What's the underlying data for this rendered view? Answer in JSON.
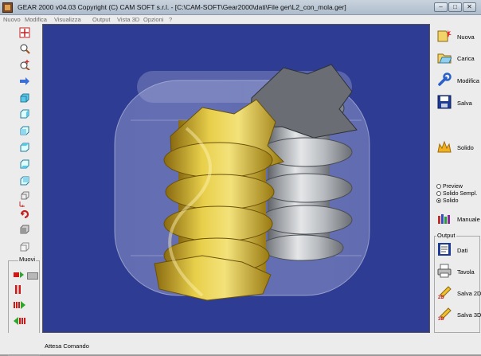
{
  "window": {
    "title": "GEAR 2000 v04.03     Copyright (C)  CAM SOFT s.r.l. - [C:\\CAM-SOFT\\Gear2000\\dati\\File ger\\L2_con_mola.ger]",
    "buttons": {
      "minimize": "–",
      "restore": "□",
      "close": "✕"
    }
  },
  "menu": [
    "Nuovo",
    "Modifica",
    "Visualizza",
    "Output",
    "Vista 3D",
    "Opzioni",
    "?"
  ],
  "left_toolbar": {
    "tools": [
      "select-center-icon",
      "zoom-window-icon",
      "zoom-in-icon",
      "pan-arrow-icon",
      "view-front-icon",
      "view-right-icon",
      "view-left-icon",
      "view-top-icon",
      "view-bottom-icon",
      "view-back-icon",
      "view-iso-icon",
      "rotate-icon",
      "undo-view-icon",
      "shade-box-icon",
      "wire-box-icon"
    ],
    "muovi_label": "Muovi"
  },
  "right_toolbar": {
    "buttons": [
      {
        "label": "Nuova",
        "icon": "new-file-icon"
      },
      {
        "label": "Carica",
        "icon": "open-folder-icon"
      },
      {
        "label": "Modifica",
        "icon": "wrench-icon"
      },
      {
        "label": "Salva",
        "icon": "floppy-disk-icon"
      },
      {
        "label": "Solido",
        "icon": "solid-crown-icon"
      }
    ],
    "render_modes": [
      {
        "label": "Preview",
        "selected": false
      },
      {
        "label": "Solido Sempl.",
        "selected": false
      },
      {
        "label": "Solido",
        "selected": true
      }
    ],
    "manuale": "Manuale",
    "output_label": "Output",
    "output_buttons": [
      {
        "label": "Dati",
        "icon": "data-sheet-icon"
      },
      {
        "label": "Tavola",
        "icon": "printer-icon"
      },
      {
        "label": "Salva 2D",
        "icon": "pencil-2d-icon"
      },
      {
        "label": "Salva 3D",
        "icon": "pencil-3d-icon"
      }
    ]
  },
  "status": {
    "text": "Attesa Comando"
  },
  "colors": {
    "viewport_bg": "#2f3c93",
    "gear_gold": "#d9b82a",
    "gear_gray": "#9ea2a6"
  }
}
